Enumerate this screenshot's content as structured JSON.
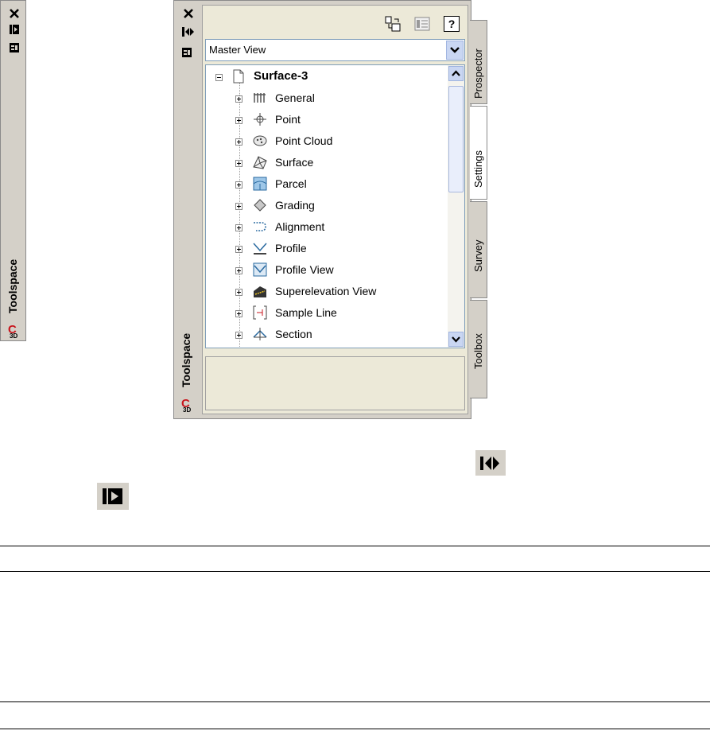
{
  "collapsed_toolspace": {
    "title": "Toolspace",
    "logo_letter": "C",
    "logo_sub": "3D"
  },
  "toolspace": {
    "title": "Toolspace",
    "logo_letter": "C",
    "logo_sub": "3D",
    "view_select": "Master View",
    "tree": {
      "root": "Surface-3",
      "items": [
        "General",
        "Point",
        "Point Cloud",
        "Surface",
        "Parcel",
        "Grading",
        "Alignment",
        "Profile",
        "Profile View",
        "Superelevation View",
        "Sample Line",
        "Section"
      ]
    },
    "tabs": [
      "Prospector",
      "Settings",
      "Survey",
      "Toolbox"
    ],
    "active_tab": "Settings",
    "help_label": "?"
  },
  "colors": {
    "panel_bg": "#d4d0c8",
    "logo_red": "#c8161d",
    "scroll_blue": "#c9d6f2"
  }
}
